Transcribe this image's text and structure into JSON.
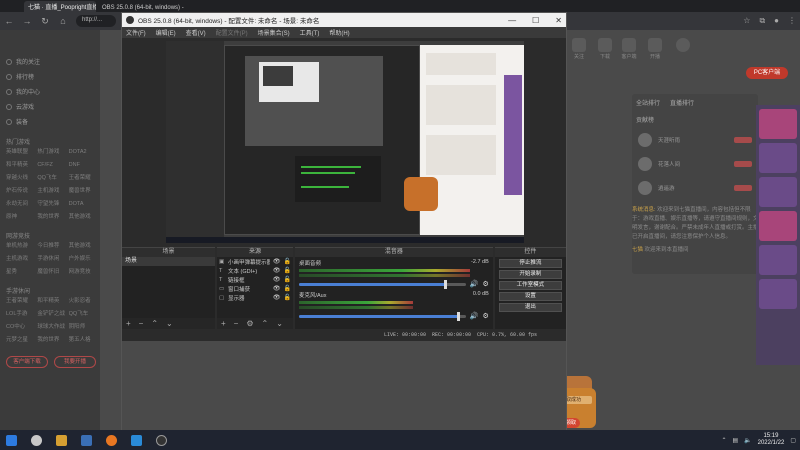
{
  "browser": {
    "tabs": [
      {
        "label": "七猫 · 直播_Poopright直播_在线...",
        "active": true
      },
      {
        "label": "OBS 25.0.8 (64-bit, windows) - 配置文件: 未命名 - 场景: 未命名",
        "active": false
      }
    ],
    "address": "http://...",
    "nav": {
      "back": "←",
      "forward": "→",
      "reload": "↻",
      "home": "⌂"
    }
  },
  "obs": {
    "title": "OBS 25.0.8 (64-bit, windows) - 配置文件: 未命名 - 场景: 未命名",
    "window_controls": {
      "minimize": "—",
      "maximize": "☐",
      "close": "✕"
    },
    "menu": [
      {
        "label": "文件(F)",
        "enabled": true
      },
      {
        "label": "编辑(E)",
        "enabled": true
      },
      {
        "label": "查看(V)",
        "enabled": true
      },
      {
        "label": "配置文件(P)",
        "enabled": false
      },
      {
        "label": "场景集合(S)",
        "enabled": true
      },
      {
        "label": "工具(T)",
        "enabled": true
      },
      {
        "label": "帮助(H)",
        "enabled": true
      }
    ],
    "docks": {
      "scenes": {
        "title": "场景",
        "items": [
          "场景"
        ]
      },
      "sources": {
        "title": "来源",
        "items": [
          {
            "label": "小画甲弹幕提示器",
            "icon": "▣"
          },
          {
            "label": "文本 (GDI+)",
            "icon": "T"
          },
          {
            "label": "链接框",
            "icon": "T"
          },
          {
            "label": "窗口捕获",
            "icon": "▭"
          },
          {
            "label": "显示器",
            "icon": "▢"
          }
        ]
      },
      "mixer": {
        "title": "混音器",
        "tracks": [
          {
            "name": "桌面音频",
            "db": "-2.7 dB",
            "level": 0.9,
            "volume": 0.88
          },
          {
            "name": "麦克风/Aux",
            "db": "0.0 dB",
            "level": 0.6,
            "volume": 0.96
          }
        ]
      },
      "controls": {
        "title": "控件",
        "buttons": [
          "停止推流",
          "开始录制",
          "工作室模式",
          "设置",
          "退出"
        ]
      }
    },
    "status": {
      "live": "LIVE: 00:00:00",
      "rec": "REC: 00:00:00",
      "cpu": "CPU: 0.7%, 60.00 fps"
    }
  },
  "web": {
    "left_nav": {
      "items": [
        "我的关注",
        "排行榜",
        "我的中心",
        "云游戏",
        "装备"
      ],
      "section1": "热门游戏",
      "grid1": [
        "英雄联盟",
        "热门游戏",
        "DOTA2",
        "和平精英",
        "CF/FZ",
        "DNF",
        "穿越火线",
        "QQ飞车",
        "王者荣耀",
        "炉石传说",
        "主机游戏",
        "魔兽世界",
        "永劫无间",
        "守望先锋",
        "DOTA",
        "原神",
        "我的世界",
        "其他游戏"
      ],
      "section2": "网游竞技",
      "grid2": [
        "单机热游",
        "今日推荐",
        "其他游戏",
        "主机游戏",
        "手游休闲",
        "户外娱乐",
        "星秀",
        "魔兽怀旧",
        "网游竞技"
      ],
      "section3": "手游休闲",
      "grid3": [
        "王者荣耀",
        "和平精英",
        "火影忍者",
        "LOL手游",
        "金铲铲之战",
        "QQ飞车",
        "CO中心",
        "球球大作战",
        "阴阳师",
        "元梦之星",
        "我的世界",
        "第五人格"
      ],
      "btn_left": "客户端下载",
      "btn_right": "我要开播"
    },
    "right": {
      "top_icons": [
        "关注",
        "下载",
        "客户端",
        "开播",
        "设置"
      ],
      "pc_btn": "PC客户端",
      "rank_tabs": [
        "全站排行",
        "直播排行"
      ],
      "rank_sub": "贡献榜",
      "rank_rows": [
        "天涯听雨",
        "花落人间",
        "逍遥游"
      ],
      "chat": [
        {
          "user": "系统消息:",
          "text": "欢迎来到七猫直播间，内容包括但不限于：游戏直播、娱乐直播等，请遵守直播间规则，文明发言，谢谢配合。严禁未成年人直播或打赏。主播已开启直播间，请您注意保护个人信息。"
        },
        {
          "user": "七猫",
          "text": "欢迎来到本直播间"
        }
      ],
      "gift_title": "新春大礼包",
      "gift_text": "恭喜领取成功",
      "gift_btn": "立即领取",
      "ad": "广告"
    }
  },
  "taskbar": {
    "time": "15:19",
    "date": "2022/1/22"
  }
}
